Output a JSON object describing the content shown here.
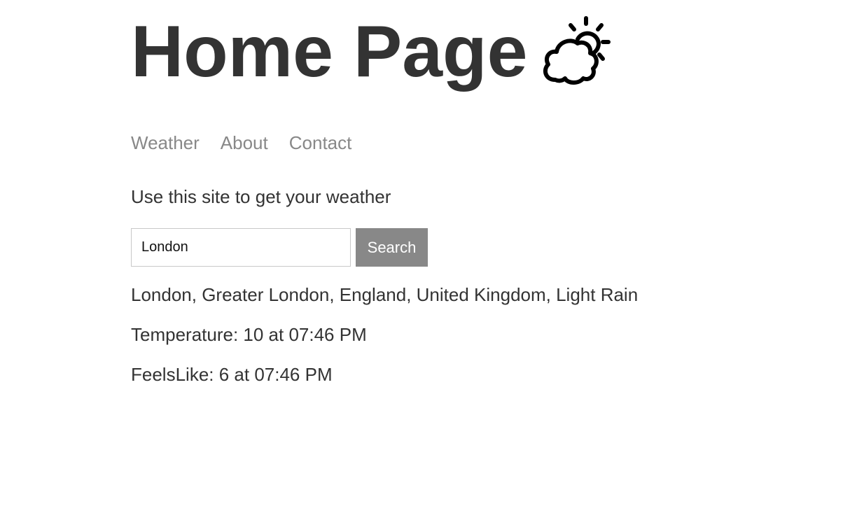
{
  "header": {
    "title": "Home Page",
    "icon": "cloud-sun-icon"
  },
  "nav": {
    "items": [
      {
        "label": "Weather"
      },
      {
        "label": "About"
      },
      {
        "label": "Contact"
      }
    ]
  },
  "intro": {
    "text": "Use this site to get your weather"
  },
  "search": {
    "value": "London",
    "button_label": "Search"
  },
  "results": {
    "location": "London, Greater London, England, United Kingdom, Light Rain",
    "temperature": "Temperature: 10 at 07:46 PM",
    "feels_like": "FeelsLike: 6 at 07:46 PM"
  },
  "colors": {
    "text": "#333333",
    "nav_link": "#888888",
    "button_bg": "#888888",
    "button_text": "#ffffff",
    "input_border": "#c8c8c8"
  }
}
